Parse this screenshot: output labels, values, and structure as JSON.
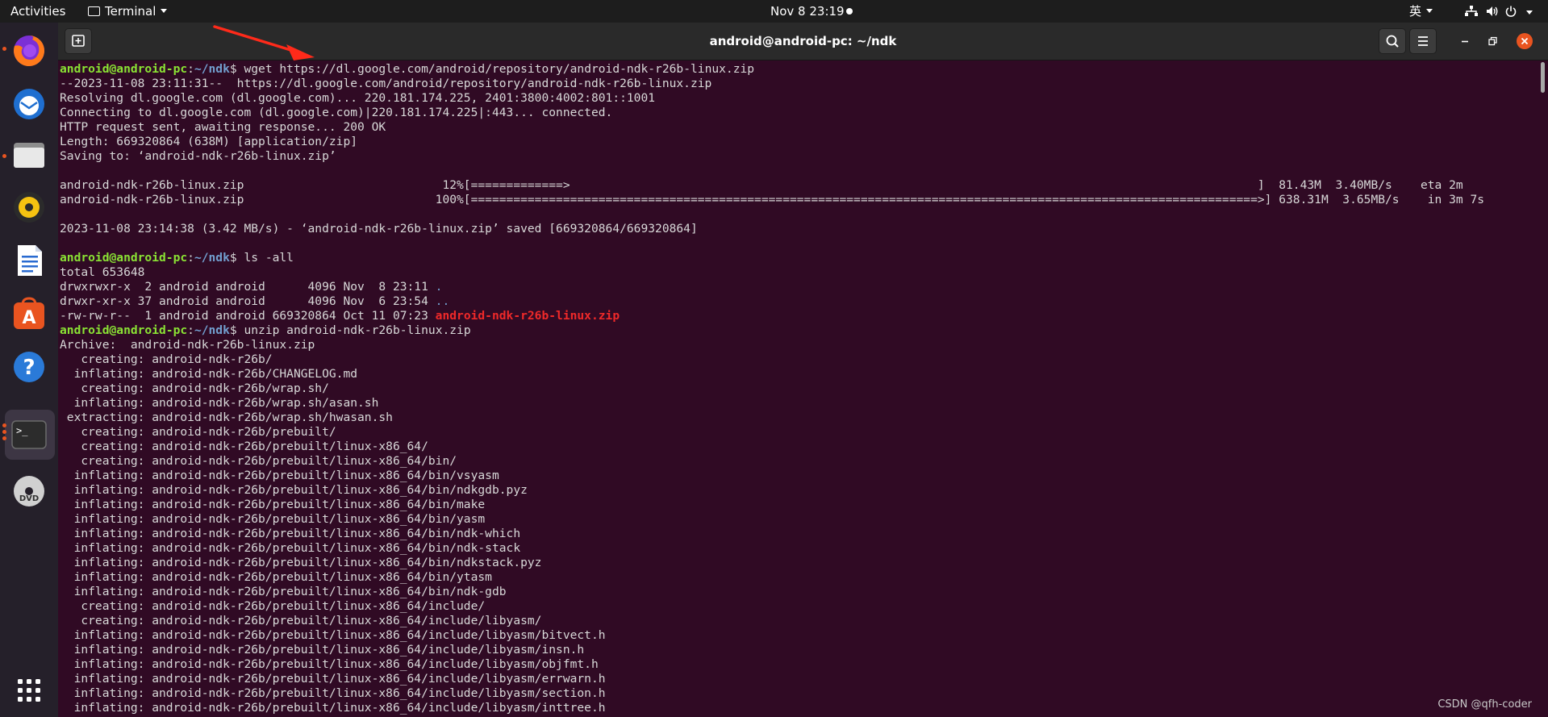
{
  "topbar": {
    "activities": "Activities",
    "app_menu": "Terminal",
    "clock": "Nov 8  23:19",
    "input_method": "英"
  },
  "window": {
    "title": "android@android-pc: ~/ndk"
  },
  "watermark": "CSDN @qfh-coder",
  "terminal": {
    "lines": [
      {
        "segments": [
          {
            "t": "android@android-pc",
            "c": "u"
          },
          {
            "t": ":"
          },
          {
            "t": "~/ndk",
            "c": "p"
          },
          {
            "t": "$ wget https://dl.google.com/android/repository/android-ndk-r26b-linux.zip"
          }
        ]
      },
      {
        "segments": [
          {
            "t": "--2023-11-08 23:11:31--  https://dl.google.com/android/repository/android-ndk-r26b-linux.zip"
          }
        ]
      },
      {
        "segments": [
          {
            "t": "Resolving dl.google.com (dl.google.com)... 220.181.174.225, 2401:3800:4002:801::1001"
          }
        ]
      },
      {
        "segments": [
          {
            "t": "Connecting to dl.google.com (dl.google.com)|220.181.174.225|:443... connected."
          }
        ]
      },
      {
        "segments": [
          {
            "t": "HTTP request sent, awaiting response... 200 OK"
          }
        ]
      },
      {
        "segments": [
          {
            "t": "Length: 669320864 (638M) [application/zip]"
          }
        ]
      },
      {
        "segments": [
          {
            "t": "Saving to: ‘android-ndk-r26b-linux.zip’"
          }
        ]
      },
      {
        "segments": [
          {
            "t": ""
          }
        ]
      },
      {
        "segments": [
          {
            "t": "android-ndk-r26b-linux.zip                            12%[=============>                                                                                                 ]  81.43M  3.40MB/s    eta 2m"
          }
        ]
      },
      {
        "segments": [
          {
            "t": "android-ndk-r26b-linux.zip                           100%[===============================================================================================================>] 638.31M  3.65MB/s    in 3m 7s"
          }
        ]
      },
      {
        "segments": [
          {
            "t": ""
          }
        ]
      },
      {
        "segments": [
          {
            "t": "2023-11-08 23:14:38 (3.42 MB/s) - ‘android-ndk-r26b-linux.zip’ saved [669320864/669320864]"
          }
        ]
      },
      {
        "segments": [
          {
            "t": ""
          }
        ]
      },
      {
        "segments": [
          {
            "t": "android@android-pc",
            "c": "u"
          },
          {
            "t": ":"
          },
          {
            "t": "~/ndk",
            "c": "p"
          },
          {
            "t": "$ ls -all"
          }
        ]
      },
      {
        "segments": [
          {
            "t": "total 653648"
          }
        ]
      },
      {
        "segments": [
          {
            "t": "drwxrwxr-x  2 android android      4096 Nov  8 23:11 "
          },
          {
            "t": ".",
            "c": "blue"
          }
        ]
      },
      {
        "segments": [
          {
            "t": "drwxr-xr-x 37 android android      4096 Nov  6 23:54 "
          },
          {
            "t": "..",
            "c": "blue"
          }
        ]
      },
      {
        "segments": [
          {
            "t": "-rw-rw-r--  1 android android 669320864 Oct 11 07:23 "
          },
          {
            "t": "android-ndk-r26b-linux.zip",
            "c": "red"
          }
        ]
      },
      {
        "segments": [
          {
            "t": "android@android-pc",
            "c": "u"
          },
          {
            "t": ":"
          },
          {
            "t": "~/ndk",
            "c": "p"
          },
          {
            "t": "$ unzip android-ndk-r26b-linux.zip"
          }
        ]
      },
      {
        "segments": [
          {
            "t": "Archive:  android-ndk-r26b-linux.zip"
          }
        ]
      },
      {
        "segments": [
          {
            "t": "   creating: android-ndk-r26b/"
          }
        ]
      },
      {
        "segments": [
          {
            "t": "  inflating: android-ndk-r26b/CHANGELOG.md"
          }
        ]
      },
      {
        "segments": [
          {
            "t": "   creating: android-ndk-r26b/wrap.sh/"
          }
        ]
      },
      {
        "segments": [
          {
            "t": "  inflating: android-ndk-r26b/wrap.sh/asan.sh"
          }
        ]
      },
      {
        "segments": [
          {
            "t": " extracting: android-ndk-r26b/wrap.sh/hwasan.sh"
          }
        ]
      },
      {
        "segments": [
          {
            "t": "   creating: android-ndk-r26b/prebuilt/"
          }
        ]
      },
      {
        "segments": [
          {
            "t": "   creating: android-ndk-r26b/prebuilt/linux-x86_64/"
          }
        ]
      },
      {
        "segments": [
          {
            "t": "   creating: android-ndk-r26b/prebuilt/linux-x86_64/bin/"
          }
        ]
      },
      {
        "segments": [
          {
            "t": "  inflating: android-ndk-r26b/prebuilt/linux-x86_64/bin/vsyasm"
          }
        ]
      },
      {
        "segments": [
          {
            "t": "  inflating: android-ndk-r26b/prebuilt/linux-x86_64/bin/ndkgdb.pyz"
          }
        ]
      },
      {
        "segments": [
          {
            "t": "  inflating: android-ndk-r26b/prebuilt/linux-x86_64/bin/make"
          }
        ]
      },
      {
        "segments": [
          {
            "t": "  inflating: android-ndk-r26b/prebuilt/linux-x86_64/bin/yasm"
          }
        ]
      },
      {
        "segments": [
          {
            "t": "  inflating: android-ndk-r26b/prebuilt/linux-x86_64/bin/ndk-which"
          }
        ]
      },
      {
        "segments": [
          {
            "t": "  inflating: android-ndk-r26b/prebuilt/linux-x86_64/bin/ndk-stack"
          }
        ]
      },
      {
        "segments": [
          {
            "t": "  inflating: android-ndk-r26b/prebuilt/linux-x86_64/bin/ndkstack.pyz"
          }
        ]
      },
      {
        "segments": [
          {
            "t": "  inflating: android-ndk-r26b/prebuilt/linux-x86_64/bin/ytasm"
          }
        ]
      },
      {
        "segments": [
          {
            "t": "  inflating: android-ndk-r26b/prebuilt/linux-x86_64/bin/ndk-gdb"
          }
        ]
      },
      {
        "segments": [
          {
            "t": "   creating: android-ndk-r26b/prebuilt/linux-x86_64/include/"
          }
        ]
      },
      {
        "segments": [
          {
            "t": "   creating: android-ndk-r26b/prebuilt/linux-x86_64/include/libyasm/"
          }
        ]
      },
      {
        "segments": [
          {
            "t": "  inflating: android-ndk-r26b/prebuilt/linux-x86_64/include/libyasm/bitvect.h"
          }
        ]
      },
      {
        "segments": [
          {
            "t": "  inflating: android-ndk-r26b/prebuilt/linux-x86_64/include/libyasm/insn.h"
          }
        ]
      },
      {
        "segments": [
          {
            "t": "  inflating: android-ndk-r26b/prebuilt/linux-x86_64/include/libyasm/objfmt.h"
          }
        ]
      },
      {
        "segments": [
          {
            "t": "  inflating: android-ndk-r26b/prebuilt/linux-x86_64/include/libyasm/errwarn.h"
          }
        ]
      },
      {
        "segments": [
          {
            "t": "  inflating: android-ndk-r26b/prebuilt/linux-x86_64/include/libyasm/section.h"
          }
        ]
      },
      {
        "segments": [
          {
            "t": "  inflating: android-ndk-r26b/prebuilt/linux-x86_64/include/libyasm/inttree.h"
          }
        ]
      }
    ]
  },
  "colors": {
    "terminal_bg": "#300a24",
    "user_host": "#8ae234",
    "path": "#729fcf",
    "archive_file": "#ef2929",
    "accent": "#e95420"
  },
  "dock": {
    "items": [
      {
        "icon": "firefox-icon",
        "running": true
      },
      {
        "icon": "thunderbird-icon",
        "running": false
      },
      {
        "icon": "files-icon",
        "running": true
      },
      {
        "icon": "rhythmbox-icon",
        "running": false
      },
      {
        "icon": "libreoffice-writer-icon",
        "running": false
      },
      {
        "icon": "ubuntu-software-icon",
        "running": false
      },
      {
        "icon": "help-icon",
        "running": false
      },
      {
        "icon": "terminal-icon",
        "running": true
      },
      {
        "icon": "dvd-icon",
        "running": false
      },
      {
        "icon": "show-applications-icon",
        "running": false
      }
    ]
  }
}
